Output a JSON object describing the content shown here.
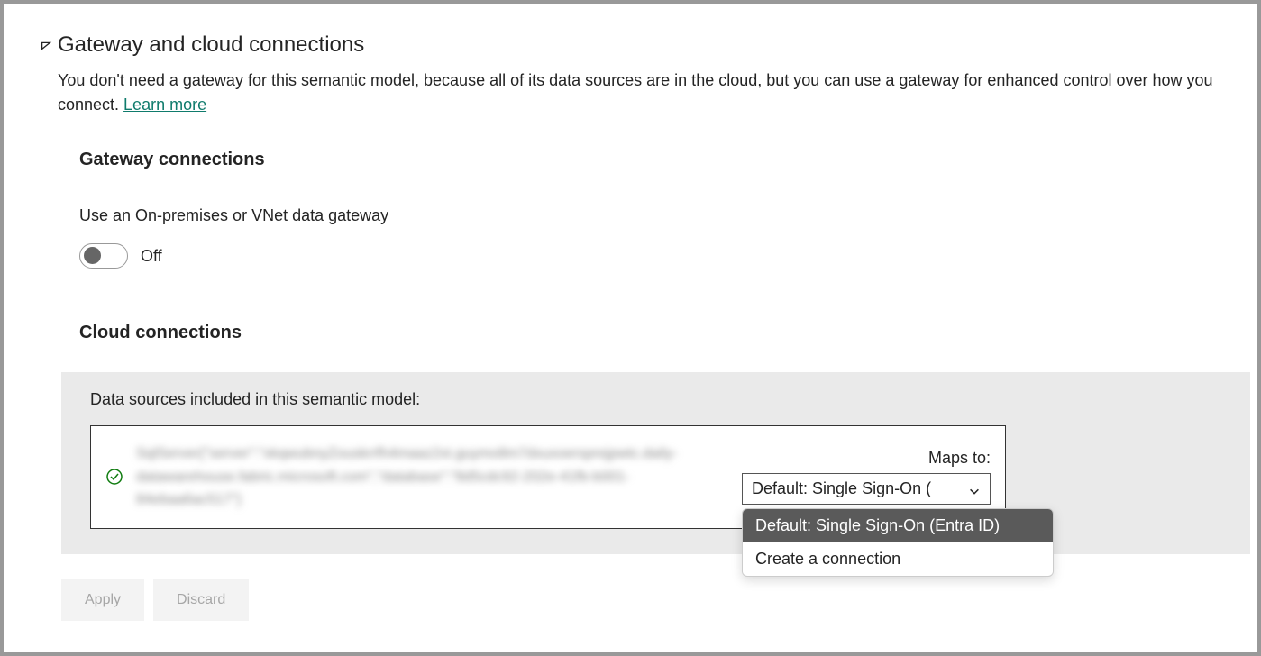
{
  "section": {
    "title": "Gateway and cloud connections",
    "description_pre": "You don't need a gateway for this semantic model, because all of its data sources are in the cloud, but you can use a gateway for enhanced control over how you connect. ",
    "learn_more": "Learn more"
  },
  "gateway": {
    "title": "Gateway connections",
    "label": "Use an On-premises or VNet data gateway",
    "toggle_state": "Off"
  },
  "cloud": {
    "title": "Cloud connections",
    "data_sources_label": "Data sources included in this semantic model:",
    "maps_to_label": "Maps to:",
    "selected_option": "Default: Single Sign-On (",
    "options": [
      "Default: Single Sign-On (Entra ID)",
      "Create a connection"
    ]
  },
  "buttons": {
    "apply": "Apply",
    "discard": "Discard"
  }
}
